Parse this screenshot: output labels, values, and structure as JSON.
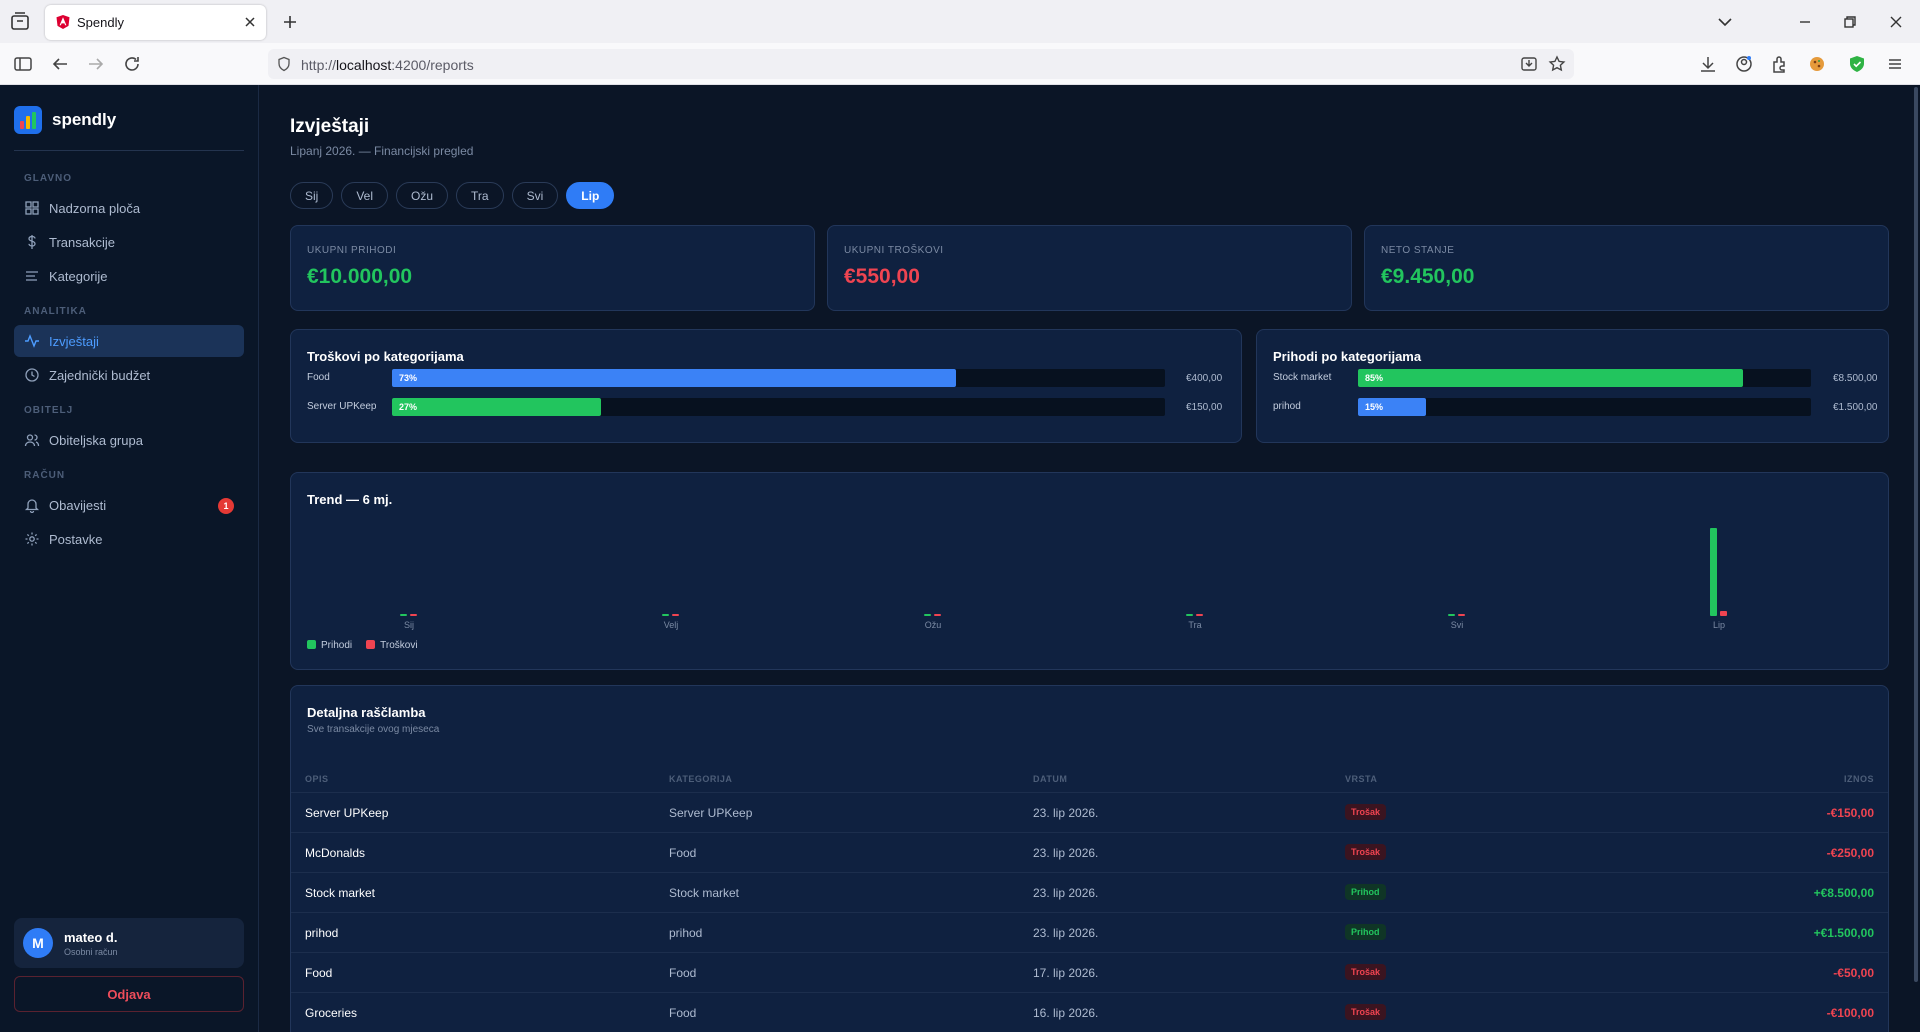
{
  "browser": {
    "tab_title": "Spendly",
    "url_prefix": "http://",
    "url_host": "localhost",
    "url_rest": ":4200/reports"
  },
  "sidebar": {
    "brand": "spendly",
    "sections": {
      "main": "GLAVNO",
      "analytics": "ANALITIKA",
      "family": "OBITELJ",
      "account": "RAČUN"
    },
    "items": [
      {
        "label": "Nadzorna ploča",
        "icon": "grid-icon"
      },
      {
        "label": "Transakcije",
        "icon": "dollar-icon"
      },
      {
        "label": "Kategorije",
        "icon": "list-icon"
      },
      {
        "label": "Izvještaji",
        "icon": "activity-icon"
      },
      {
        "label": "Zajednički budžet",
        "icon": "clock-icon"
      },
      {
        "label": "Obiteljska grupa",
        "icon": "users-icon"
      },
      {
        "label": "Obavijesti",
        "icon": "bell-icon",
        "badge": "1"
      },
      {
        "label": "Postavke",
        "icon": "gear-icon"
      }
    ],
    "user": {
      "initial": "M",
      "name": "mateo d.",
      "role": "Osobni račun"
    },
    "logout": "Odjava"
  },
  "page": {
    "title": "Izvještaji",
    "subtitle": "Lipanj 2026. — Financijski pregled",
    "months": [
      "Sij",
      "Vel",
      "Ožu",
      "Tra",
      "Svi",
      "Lip"
    ],
    "selected_month": "Lip"
  },
  "kpis": [
    {
      "label": "UKUPNI PRIHODI",
      "value": "€10.000,00",
      "color": "#22c55e"
    },
    {
      "label": "UKUPNI TROŠKOVI",
      "value": "€550,00",
      "color": "#ef4451"
    },
    {
      "label": "NETO STANJE",
      "value": "€9.450,00",
      "color": "#22c55e"
    }
  ],
  "expense_categories": {
    "title": "Troškovi po kategorijama",
    "rows": [
      {
        "name": "Food",
        "percent": 73,
        "pct_label": "73%",
        "amount": "€400,00",
        "color": "#3b82f6"
      },
      {
        "name": "Server UPKeep",
        "percent": 27,
        "pct_label": "27%",
        "amount": "€150,00",
        "color": "#22c55e"
      }
    ]
  },
  "income_categories": {
    "title": "Prihodi po kategorijama",
    "rows": [
      {
        "name": "Stock market",
        "percent": 85,
        "pct_label": "85%",
        "amount": "€8.500,00",
        "color": "#22c55e"
      },
      {
        "name": "prihod",
        "percent": 15,
        "pct_label": "15%",
        "amount": "€1.500,00",
        "color": "#3b82f6"
      }
    ]
  },
  "trend": {
    "title": "Trend — 6 mj.",
    "legend_income": "Prihodi",
    "legend_expense": "Troškovi"
  },
  "chart_data": {
    "type": "bar",
    "title": "Trend — 6 mj.",
    "categories": [
      "Sij",
      "Velj",
      "Ožu",
      "Tra",
      "Svi",
      "Lip"
    ],
    "series": [
      {
        "name": "Prihodi",
        "color": "#22c55e",
        "values": [
          0,
          0,
          0,
          0,
          0,
          10000
        ]
      },
      {
        "name": "Troškovi",
        "color": "#ef4451",
        "values": [
          0,
          0,
          0,
          0,
          0,
          550
        ]
      }
    ],
    "legend": "bottom-left",
    "grid": false
  },
  "breakdown": {
    "title": "Detaljna raščlamba",
    "subtitle": "Sve transakcije ovog mjeseca",
    "columns": [
      "OPIS",
      "KATEGORIJA",
      "DATUM",
      "VRSTA",
      "IZNOS"
    ],
    "rows": [
      {
        "desc": "Server UPKeep",
        "category": "Server UPKeep",
        "date": "23. lip 2026.",
        "type": "Trošak",
        "kind": "expense",
        "amount": "-€150,00"
      },
      {
        "desc": "McDonalds",
        "category": "Food",
        "date": "23. lip 2026.",
        "type": "Trošak",
        "kind": "expense",
        "amount": "-€250,00"
      },
      {
        "desc": "Stock market",
        "category": "Stock market",
        "date": "23. lip 2026.",
        "type": "Prihod",
        "kind": "income",
        "amount": "+€8.500,00"
      },
      {
        "desc": "prihod",
        "category": "prihod",
        "date": "23. lip 2026.",
        "type": "Prihod",
        "kind": "income",
        "amount": "+€1.500,00"
      },
      {
        "desc": "Food",
        "category": "Food",
        "date": "17. lip 2026.",
        "type": "Trošak",
        "kind": "expense",
        "amount": "-€50,00"
      },
      {
        "desc": "Groceries",
        "category": "Food",
        "date": "16. lip 2026.",
        "type": "Trošak",
        "kind": "expense",
        "amount": "-€100,00"
      }
    ]
  }
}
